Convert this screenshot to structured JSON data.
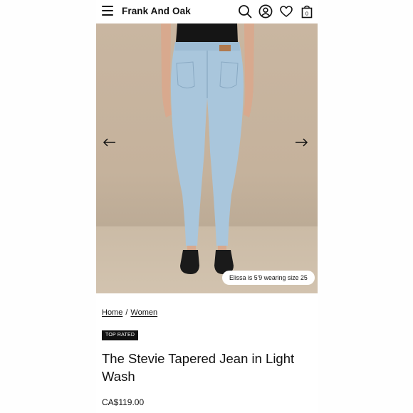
{
  "header": {
    "brand": "Frank And Oak",
    "cart_count": "0",
    "icons": [
      "menu-icon",
      "search-icon",
      "account-icon",
      "heart-icon",
      "bag-icon"
    ]
  },
  "gallery": {
    "caption": "Elissa is 5'9 wearing size 25",
    "prev_icon": "arrow-left-icon",
    "next_icon": "arrow-right-icon"
  },
  "breadcrumb": {
    "home": "Home",
    "separator": "/",
    "women": "Women"
  },
  "product": {
    "badge": "TOP RATED",
    "title": "The Stevie Tapered Jean in Light Wash",
    "price": "CA$119.00"
  },
  "colors": {
    "text": "#111111",
    "background": "#ffffff",
    "hero_bg": "#c7b49f",
    "denim": "#a9c6dc"
  }
}
